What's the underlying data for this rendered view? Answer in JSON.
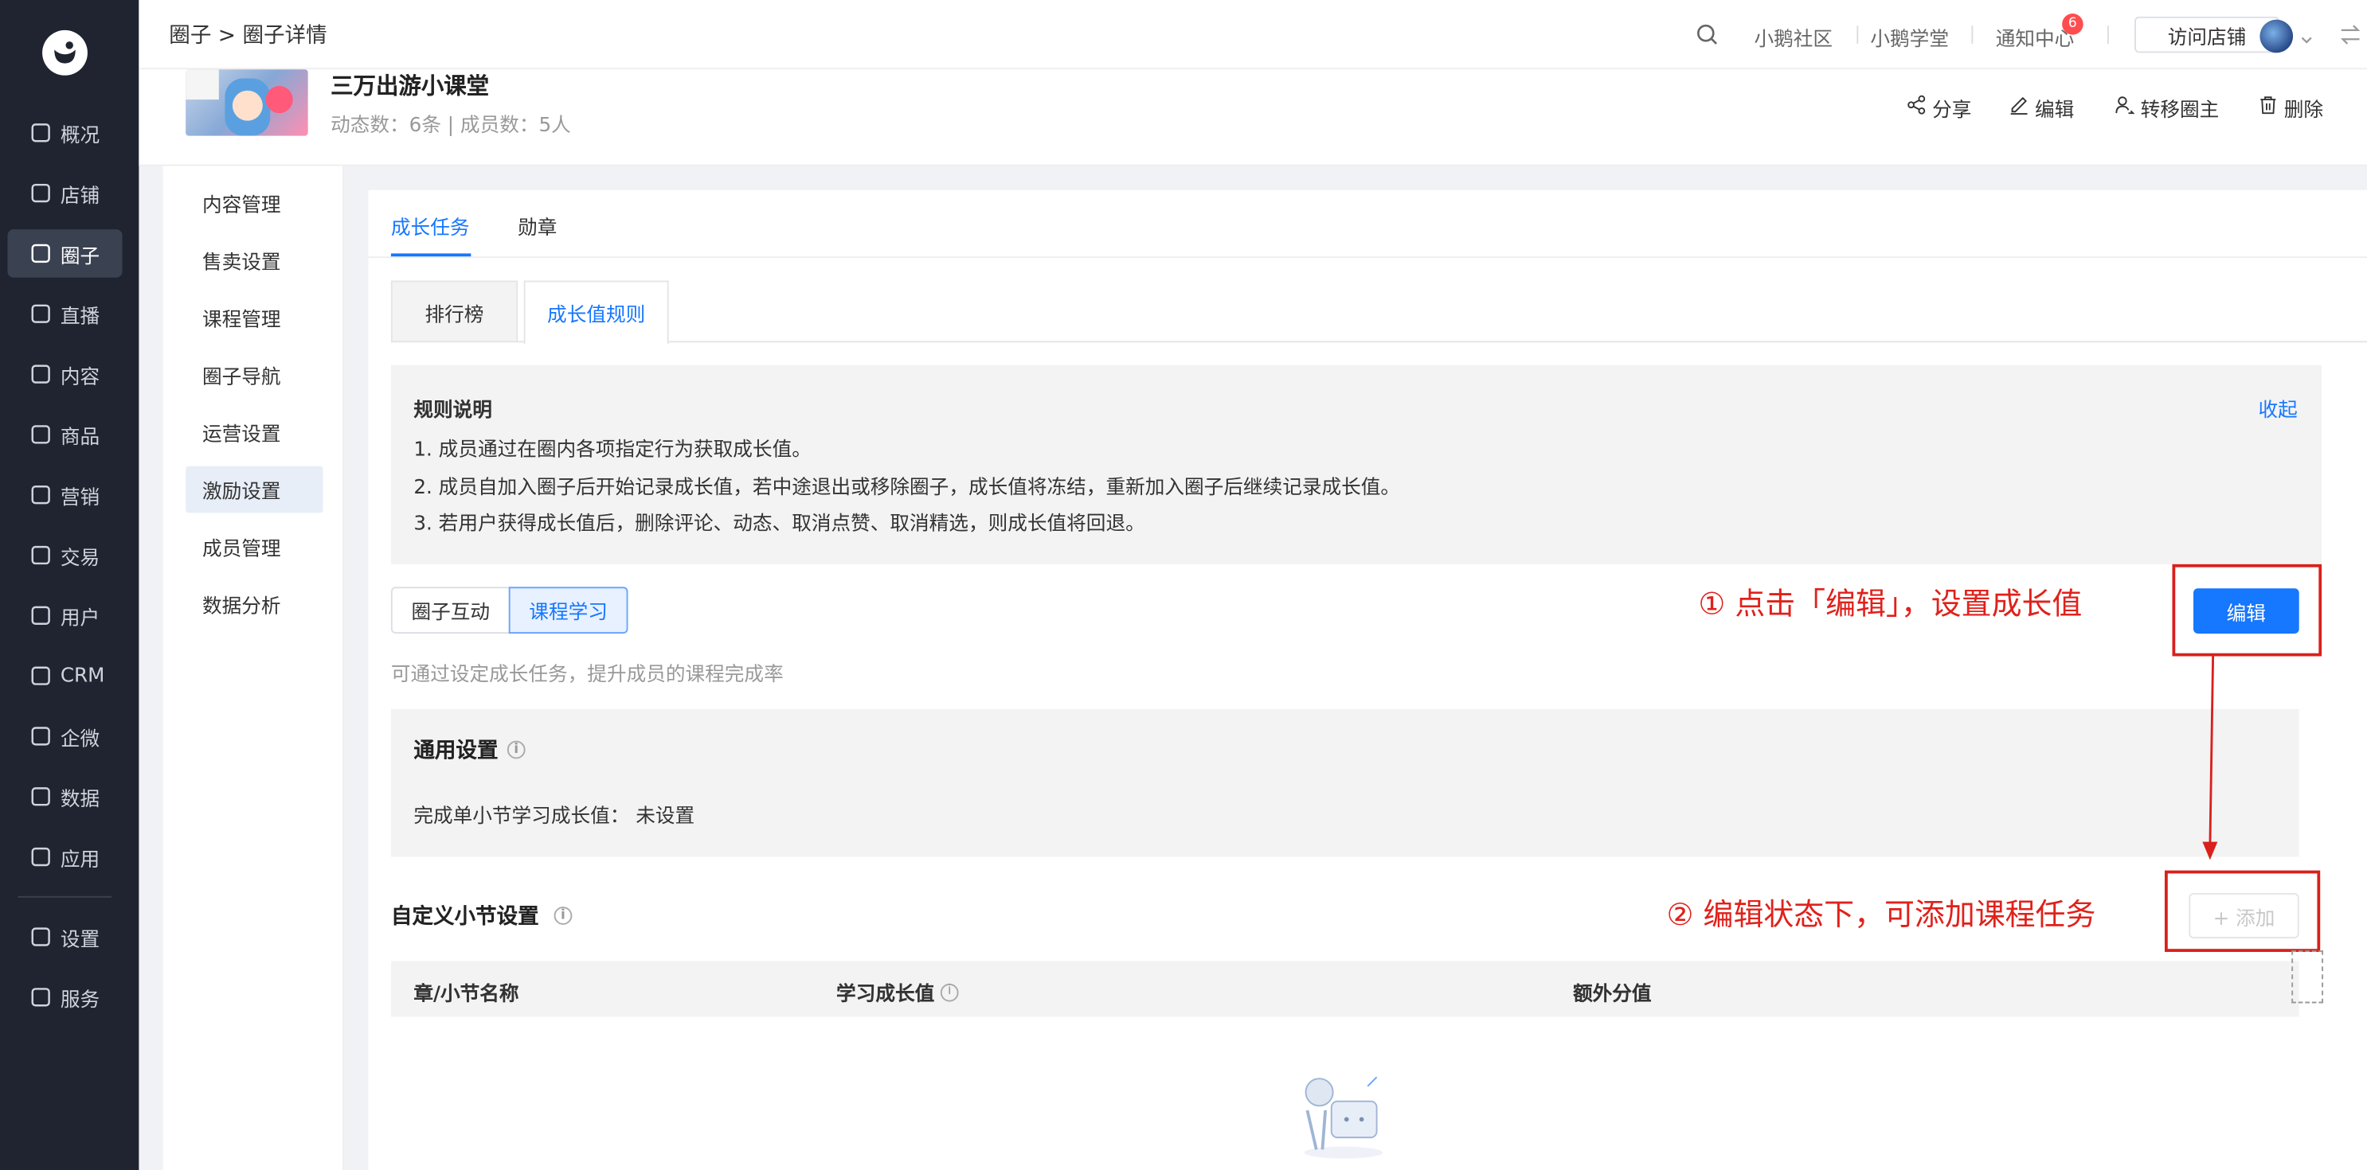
{
  "sidebar": {
    "items": [
      {
        "label": "概况",
        "icon": "pie-chart-icon"
      },
      {
        "label": "店铺",
        "icon": "store-icon"
      },
      {
        "label": "圈子",
        "icon": "community-icon"
      },
      {
        "label": "直播",
        "icon": "live-icon"
      },
      {
        "label": "内容",
        "icon": "document-icon"
      },
      {
        "label": "商品",
        "icon": "bag-icon"
      },
      {
        "label": "营销",
        "icon": "megaphone-icon"
      },
      {
        "label": "交易",
        "icon": "transaction-icon"
      },
      {
        "label": "用户",
        "icon": "user-icon"
      },
      {
        "label": "CRM",
        "icon": "crm-icon"
      },
      {
        "label": "企微",
        "icon": "wecom-icon"
      },
      {
        "label": "数据",
        "icon": "chart-icon"
      },
      {
        "label": "应用",
        "icon": "apps-icon"
      }
    ],
    "bottom": [
      {
        "label": "设置",
        "icon": "gear-icon"
      },
      {
        "label": "服务",
        "icon": "service-icon"
      }
    ],
    "active": "圈子"
  },
  "header": {
    "breadcrumb": "圈子 > 圈子详情",
    "links": [
      "小鹅社区",
      "小鹅学堂",
      "通知中心"
    ],
    "notification_count": "6",
    "visit_store": "访问店铺"
  },
  "circle": {
    "title": "三万出游小课堂",
    "stats": "动态数：6条 | 成员数：5人",
    "actions": [
      "分享",
      "编辑",
      "转移圈主",
      "删除"
    ]
  },
  "left_menu": {
    "items": [
      "内容管理",
      "售卖设置",
      "课程管理",
      "圈子导航",
      "运营设置",
      "激励设置",
      "成员管理",
      "数据分析"
    ],
    "active": "激励设置"
  },
  "tabs": {
    "main": [
      "成长任务",
      "勋章"
    ],
    "active": "成长任务"
  },
  "subtabs": {
    "items": [
      "排行榜",
      "成长值规则"
    ],
    "active": "成长值规则"
  },
  "rules": {
    "title": "规则说明",
    "collapse": "收起",
    "lines": [
      "1. 成员通过在圈内各项指定行为获取成长值。",
      "2. 成员自加入圈子后开始记录成长值，若中途退出或移除圈子，成长值将冻结，重新加入圈子后继续记录成长值。",
      "3. 若用户获得成长值后，删除评论、动态、取消点赞、取消精选，则成长值将回退。"
    ]
  },
  "segment": {
    "items": [
      "圈子互动",
      "课程学习"
    ],
    "active": "课程学习"
  },
  "hint": "可通过设定成长任务，提升成员的课程完成率",
  "general": {
    "title": "通用设置",
    "row_label": "完成单小节学习成长值：",
    "row_value": "未设置"
  },
  "custom": {
    "title": "自定义小节设置",
    "columns": [
      "章/小节名称",
      "学习成长值",
      "额外分值"
    ]
  },
  "buttons": {
    "edit": "编辑",
    "add": "+ 添加"
  },
  "annotations": {
    "step1": "① 点击「编辑」，设置成长值",
    "step2": "② 编辑状态下，可添加课程任务"
  },
  "colors": {
    "primary": "#1677ff",
    "annotation": "#e0211b",
    "sidebar": "#1f2430"
  }
}
